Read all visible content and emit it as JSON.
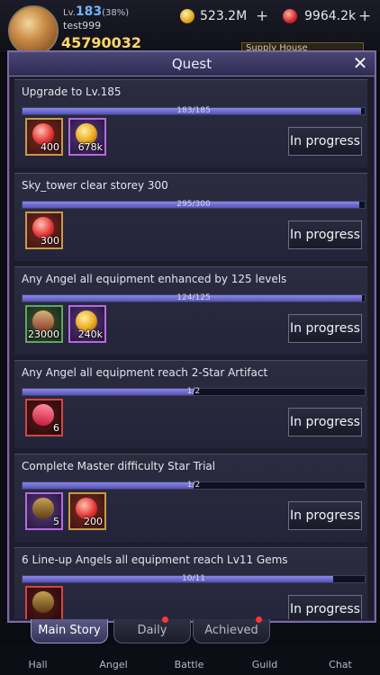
{
  "header": {
    "level_prefix": "Lv.",
    "level": "183",
    "level_percent": "(38%)",
    "username": "test999",
    "power": "45790032",
    "gold": "523.2M",
    "gems": "9964.2k",
    "plus": "+",
    "support_label": "Supply House"
  },
  "panel": {
    "title": "Quest",
    "close_symbol": "✕"
  },
  "quests": [
    {
      "title": "Upgrade to Lv.185",
      "progress_text": "183/185",
      "progress": 0.989,
      "status": "In progress",
      "rewards": [
        {
          "icon": "red-gem-icon",
          "qty": "400",
          "frame": "gold",
          "glyph": "g-gem"
        },
        {
          "icon": "gold-coin-icon",
          "qty": "678k",
          "frame": "purple",
          "glyph": "g-gold"
        }
      ]
    },
    {
      "title": "Sky_tower clear storey 300",
      "progress_text": "295/300",
      "progress": 0.983,
      "status": "In progress",
      "rewards": [
        {
          "icon": "red-gem-icon",
          "qty": "300",
          "frame": "gold",
          "glyph": "g-gem"
        }
      ]
    },
    {
      "title": "Any Angel all equipment enhanced by 125 levels",
      "progress_text": "124/125",
      "progress": 0.992,
      "status": "In progress",
      "rewards": [
        {
          "icon": "potion-icon",
          "qty": "23000",
          "frame": "green",
          "glyph": "g-potion"
        },
        {
          "icon": "gold-coin-icon",
          "qty": "240k",
          "frame": "purple",
          "glyph": "g-gold"
        }
      ]
    },
    {
      "title": "Any Angel all equipment reach 2-Star Artifact",
      "progress_text": "1/2",
      "progress": 0.5,
      "status": "In progress",
      "rewards": [
        {
          "icon": "crystal-icon",
          "qty": "6",
          "frame": "red",
          "glyph": "g-crystal"
        }
      ]
    },
    {
      "title": "Complete Master difficulty Star Trial",
      "progress_text": "1/2",
      "progress": 0.5,
      "status": "In progress",
      "rewards": [
        {
          "icon": "gem-chest-icon",
          "qty": "5",
          "frame": "purple",
          "glyph": "g-chest"
        },
        {
          "icon": "red-gem-icon",
          "qty": "200",
          "frame": "gold",
          "glyph": "g-gem"
        }
      ]
    },
    {
      "title": "6 Line-up Angels all equipment reach Lv11 Gems",
      "progress_text": "10/11",
      "progress": 0.909,
      "status": "In progress",
      "rewards": [
        {
          "icon": "gem-chest-icon",
          "qty": "",
          "frame": "red",
          "glyph": "g-chest"
        }
      ]
    }
  ],
  "tabs": [
    {
      "label": "Main Story",
      "active": true,
      "badge": false
    },
    {
      "label": "Daily",
      "active": false,
      "badge": true
    },
    {
      "label": "Achieved",
      "active": false,
      "badge": true
    }
  ],
  "nav": [
    {
      "label": "Hall",
      "icon": "hall-icon"
    },
    {
      "label": "Angel",
      "icon": "angel-icon"
    },
    {
      "label": "Battle",
      "icon": "battle-icon"
    },
    {
      "label": "Guild",
      "icon": "guild-icon"
    },
    {
      "label": "Chat",
      "icon": "chat-icon"
    }
  ],
  "colors": {
    "accent": "#7c6aa4",
    "progress_fill": "#6f6bd0",
    "badge": "#ff3434",
    "power": "#ffd86a",
    "level": "#6fb6ff"
  }
}
